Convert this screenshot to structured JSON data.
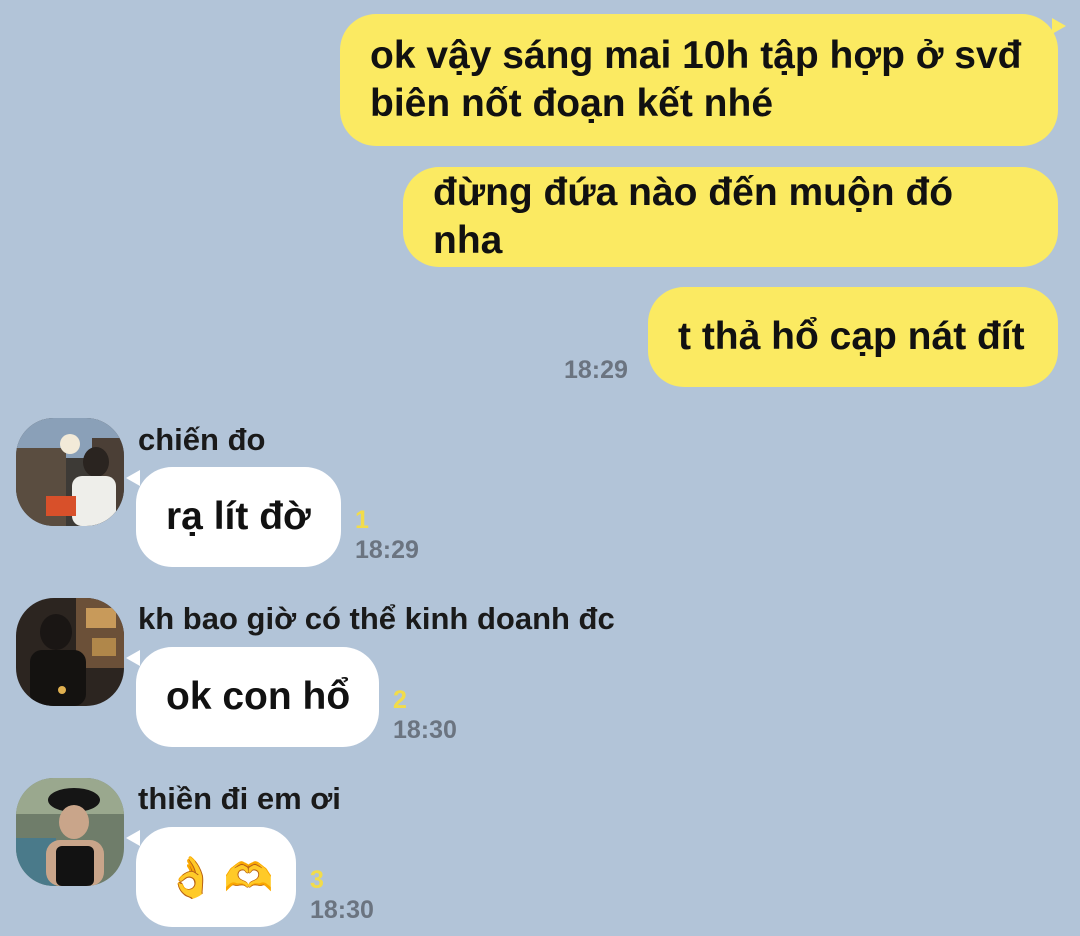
{
  "colors": {
    "background": "#b2c4d8",
    "outgoing_bubble": "#fbea62",
    "incoming_bubble": "#ffffff",
    "timestamp": "#6b7480",
    "unread_count": "#f2dc4a"
  },
  "outgoing": {
    "messages": [
      "ok vậy sáng mai 10h tập hợp ở svđ\nbiên nốt đoạn kết nhé",
      "đừng đứa nào đến muộn đó nha",
      "t thả hổ cạp nát đít"
    ],
    "time": "18:29"
  },
  "incoming": [
    {
      "sender": "chiến đo",
      "text": "rạ lít đờ",
      "unread": "1",
      "time": "18:29",
      "avatar_icon": "user-avatar-photo"
    },
    {
      "sender": "kh bao giờ có thể kinh doanh đc",
      "text": "ok con hổ",
      "unread": "2",
      "time": "18:30",
      "avatar_icon": "user-avatar-photo"
    },
    {
      "sender": "thiền đi em ơi",
      "emoji_1": "👌",
      "emoji_2": "🫶",
      "unread": "3",
      "time": "18:30",
      "avatar_icon": "user-avatar-photo"
    }
  ]
}
